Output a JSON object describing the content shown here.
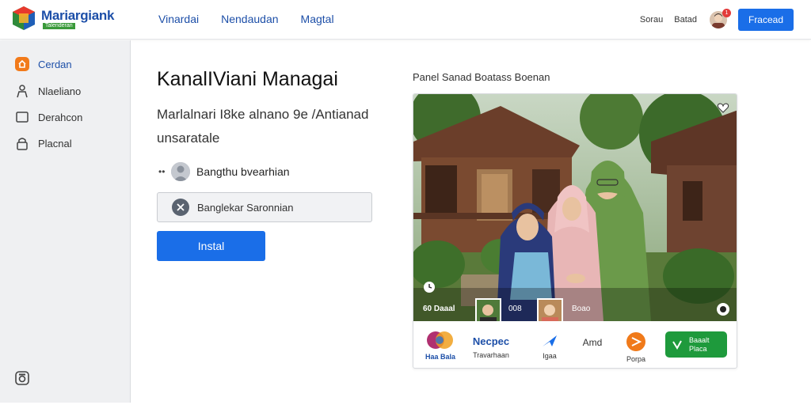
{
  "header": {
    "brand": "Mariargiank",
    "brand_sub": "Talenderan",
    "nav": [
      "Vinardai",
      "Nendaudan",
      "Magtal"
    ],
    "link1": "Sorau",
    "link2": "Batad",
    "notifications": "1",
    "button": "Fracead"
  },
  "sidebar": {
    "items": [
      {
        "label": "Cerdan",
        "icon": "home-icon"
      },
      {
        "label": "Nlaeliano",
        "icon": "user-icon"
      },
      {
        "label": "Derahcon",
        "icon": "window-icon"
      },
      {
        "label": "Placnal",
        "icon": "lock-icon"
      }
    ],
    "bottom_icon": "camera-icon"
  },
  "main": {
    "title": "KanalIViani Managai",
    "subtitle": "Marlalnari I8ke alnano 9e /Antianad unsaratale",
    "user_dots": "••",
    "user_name": "Bangthu bvearhian",
    "field_value": "Banglekar Saronnian",
    "install": "Instal"
  },
  "panel": {
    "title": "Panel Sanad Boatass Boenan",
    "caption_left": "60 Daaal",
    "caption_mid": "008",
    "caption_right": "Boao",
    "bar": {
      "item1_label": "Haa Bala",
      "item2_title": "Necpec",
      "item2_sub": "Travarhaan",
      "item3_label": "Igaa",
      "item4_label": "Amd",
      "item5_label": "Porpa",
      "button_line1": "Baaalt",
      "button_line2": "Placa"
    }
  },
  "colors": {
    "accent": "#1a6ee8",
    "brand": "#1d4fa8",
    "green": "#1e9a3c",
    "sidebar_bg": "#eff0f2",
    "badge": "#e33b3b"
  }
}
